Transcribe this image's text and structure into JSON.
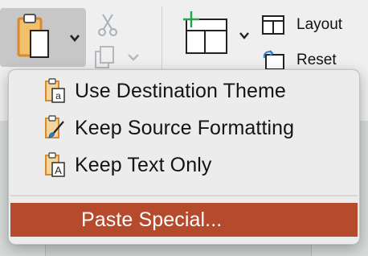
{
  "colors": {
    "menu_background": "#ececec",
    "highlight": "#b64a2c",
    "highlight_text": "#ffffff",
    "clipboard_orange": "#d9892e",
    "new_slide_plus": "#29a34a"
  },
  "ribbon": {
    "layout_label": "Layout",
    "reset_label": "Reset"
  },
  "paste_menu": {
    "items": [
      {
        "label": "Use Destination Theme",
        "icon": "clipboard-theme-icon"
      },
      {
        "label": "Keep Source Formatting",
        "icon": "clipboard-brush-icon"
      },
      {
        "label": "Keep Text Only",
        "icon": "clipboard-text-icon"
      }
    ],
    "special": {
      "label": "Paste Special..."
    }
  }
}
